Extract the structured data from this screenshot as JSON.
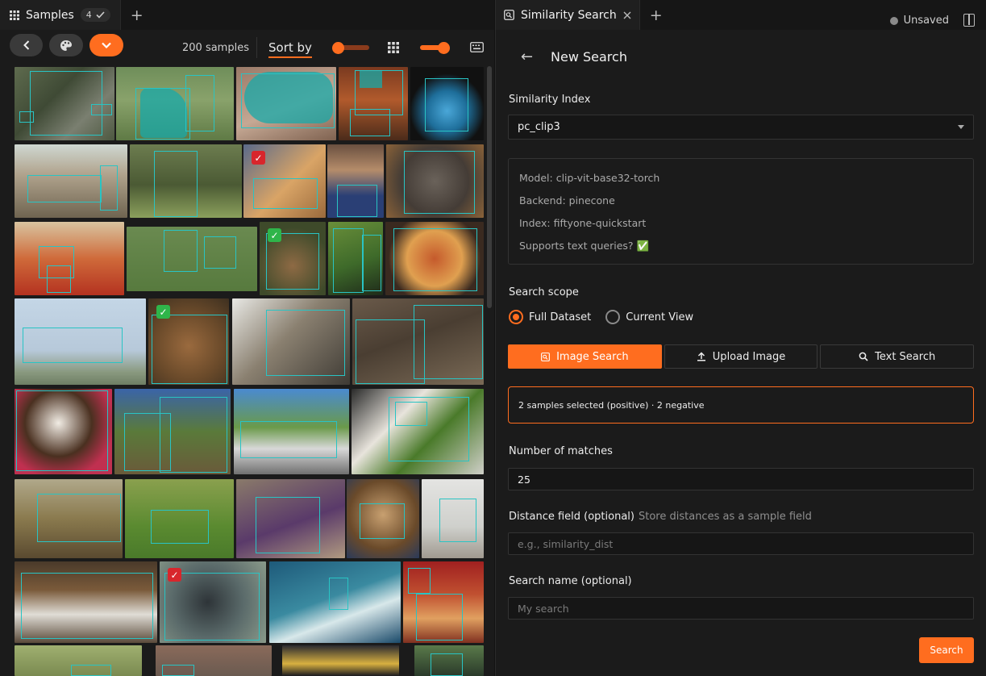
{
  "left_panel": {
    "tab": {
      "label": "Samples",
      "badge": "4"
    },
    "toolbar": {
      "count": "200 samples",
      "sort_label": "Sort by"
    }
  },
  "right_panel": {
    "tab": {
      "label": "Similarity Search"
    },
    "unsaved": "Unsaved",
    "title": "New Search",
    "similarity_index": {
      "label": "Similarity Index",
      "value": "pc_clip3"
    },
    "info": {
      "model": "Model: clip-vit-base32-torch",
      "backend": "Backend: pinecone",
      "index": "Index: fiftyone-quickstart",
      "supports": "Supports text queries? ✅"
    },
    "scope": {
      "label": "Search scope",
      "options": [
        "Full Dataset",
        "Current View"
      ]
    },
    "modes": [
      "Image Search",
      "Upload Image",
      "Text Search"
    ],
    "selection": "2 samples selected (positive) · 2 negative",
    "matches": {
      "label": "Number of matches",
      "value": "25"
    },
    "distance": {
      "label": "Distance field (optional)",
      "hint": "Store distances as a sample field",
      "placeholder": "e.g., similarity_dist"
    },
    "search_name": {
      "label": "Search name (optional)",
      "placeholder": "My search"
    },
    "search_button": "Search"
  },
  "colors": {
    "accent": "#ff6d1f",
    "label_box": "#29c4c4",
    "positive": "#2fb54a",
    "negative": "#d8262c"
  }
}
